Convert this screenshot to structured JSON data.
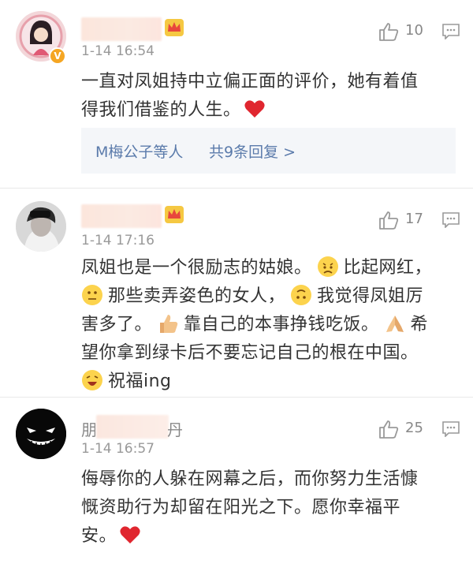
{
  "comments": [
    {
      "time": "1-14 16:54",
      "likes": "10",
      "lines": [
        "一直对凤姐持中立偏正面的评价，她有着值",
        "得我们借鉴的人生。"
      ],
      "reply": {
        "user": "M梅公子等人",
        "count": "共9条回复 >"
      }
    },
    {
      "time": "1-14 17:16",
      "likes": "17",
      "segments": [
        "凤姐也是一个很励志的姑娘。",
        "比起网红，",
        "那些卖弄姿色的女人，",
        "我觉得凤姐厉",
        "害多了。",
        "靠自己的本事挣钱吃饭。",
        "希",
        "望你拿到绿卡后不要忘记自己的根在中国。",
        "祝福ing"
      ]
    },
    {
      "name_visible_start": "朋",
      "name_visible_end": "丹",
      "time": "1-14 16:57",
      "likes": "25",
      "lines": [
        "侮辱你的人躲在网幕之后，而你努力生活慷",
        "慨资助行为却留在阳光之下。愿你幸福平",
        "安。"
      ]
    }
  ],
  "colors": {
    "link": "#5b7bab",
    "heart": "#e0262f",
    "text": "#333333",
    "meta": "#999999"
  },
  "icons": [
    "thumbs-up-icon",
    "comment-icon",
    "crown-icon",
    "verified-icon",
    "heart-icon"
  ]
}
